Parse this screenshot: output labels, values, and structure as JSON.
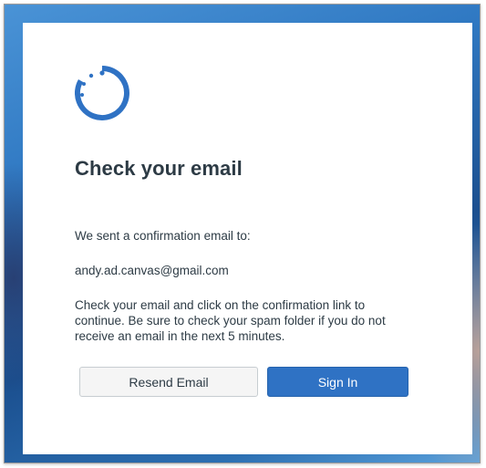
{
  "dialog": {
    "heading": "Check your email",
    "sent_label": "We sent a confirmation email to:",
    "email": "andy.ad.canvas@gmail.com",
    "instructions": "Check your email and click on the confirmation link to continue. Be sure to check your spam folder if you do not receive an email in the next 5 minutes.",
    "resend_label": "Resend Email",
    "signin_label": "Sign In"
  },
  "logo": {
    "icon": "canvas-logo-icon",
    "color": "#2f72c4"
  },
  "colors": {
    "text": "#2d3b45",
    "primary_button": "#2f72c4",
    "secondary_button": "#f5f5f5"
  }
}
